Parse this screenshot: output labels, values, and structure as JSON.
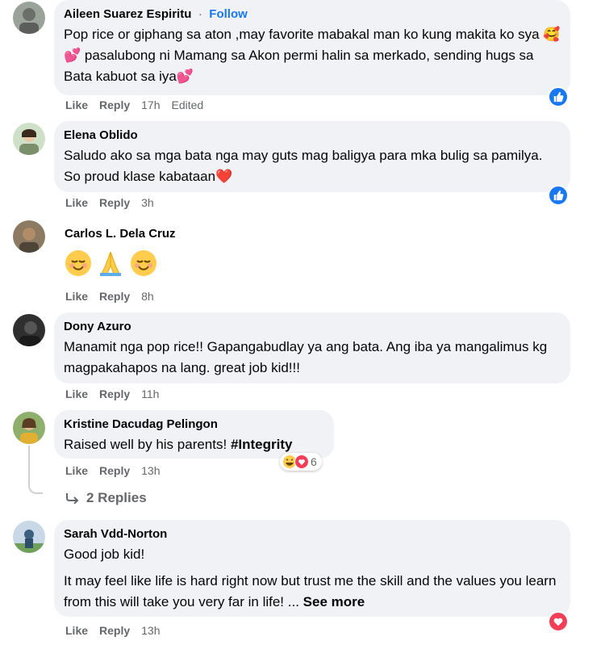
{
  "comments": [
    {
      "name": "Aileen Suarez Espiritu",
      "follow": "Follow",
      "dot": "·",
      "text": "Pop rice or giphang sa aton ,may favorite mabakal man ko kung makita ko sya 🥰💕 pasalubong ni Mamang sa Akon permi halin sa merkado, sending hugs sa Bata kabuot sa iya💕",
      "like": "Like",
      "reply": "Reply",
      "time": "17h",
      "edited": "Edited",
      "reaction": "like"
    },
    {
      "name": "Elena Oblido",
      "text": "Saludo ako sa mga bata nga may guts mag baligya para mka bulig sa pamilya. So proud klase kabataan❤️",
      "like": "Like",
      "reply": "Reply",
      "time": "3h",
      "reaction": "like"
    },
    {
      "name": "Carlos L. Dela Cruz",
      "emojis": [
        "smiling-relieved",
        "praying-hands",
        "smiling-relieved"
      ],
      "like": "Like",
      "reply": "Reply",
      "time": "8h"
    },
    {
      "name": "Dony Azuro",
      "text": "Manamit nga pop rice!! Gapangabudlay ya ang bata. Ang iba ya mangalimus kg magpakahapos na lang. great job kid!!!",
      "like": "Like",
      "reply": "Reply",
      "time": "11h"
    },
    {
      "name": "Kristine Dacudag Pelingon",
      "text_prefix": "Raised well by his parents! ",
      "hashtag": "#Integrity",
      "like": "Like",
      "reply": "Reply",
      "time": "13h",
      "reaction_count": "6",
      "replies_label": "2 Replies"
    },
    {
      "name": "Sarah Vdd-Norton",
      "text_line1": "Good job kid!",
      "text_line2": "It may feel like life is hard right now but trust me the skill and the values you learn from this will take you very far in life! ... ",
      "see_more": "See more",
      "like": "Like",
      "reply": "Reply",
      "time": "13h",
      "reaction": "love"
    }
  ],
  "colors": {
    "bubble": "#f0f2f5",
    "link": "#1877f2",
    "meta": "#65676b",
    "like_badge": "#1877f2",
    "love_badge": "#f33e58"
  }
}
